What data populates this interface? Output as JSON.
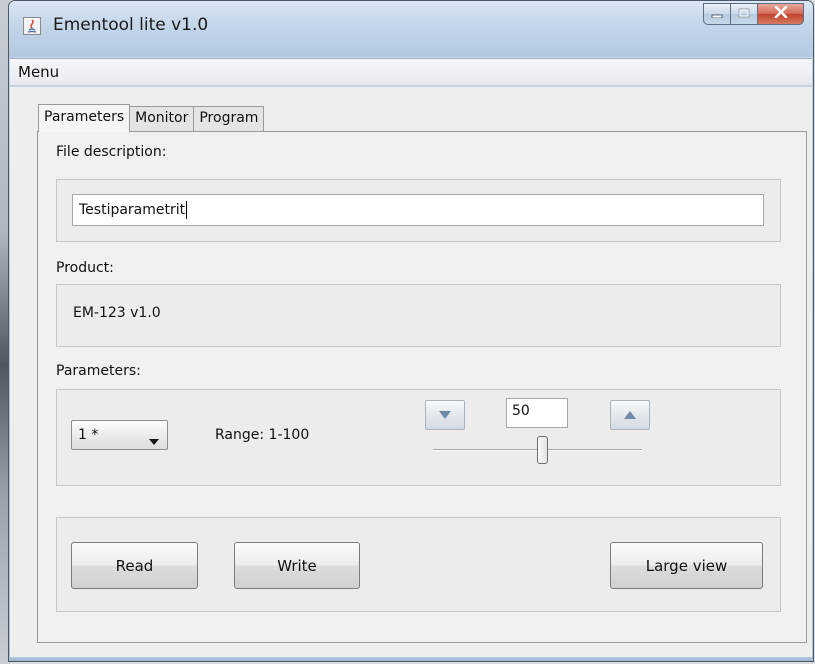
{
  "window": {
    "title": "Ementool lite v1.0",
    "controls": [
      "minimize-icon",
      "maximize-icon",
      "close-icon"
    ],
    "accent_close": "#c7442d"
  },
  "menubar": {
    "items": [
      {
        "label": "Menu"
      }
    ]
  },
  "tabs": [
    {
      "label": "Parameters",
      "active": true
    },
    {
      "label": "Monitor",
      "active": false
    },
    {
      "label": "Program",
      "active": false
    }
  ],
  "file_description": {
    "label": "File description:",
    "value": "Testiparametrit"
  },
  "product": {
    "label": "Product:",
    "value": "EM-123  v1.0"
  },
  "parameters": {
    "label": "Parameters:",
    "selected": "1 *",
    "range_text": "Range: 1-100",
    "value": "50",
    "slider_fraction": 0.5
  },
  "actions": {
    "read_label": "Read",
    "write_label": "Write",
    "large_view_label": "Large view"
  }
}
